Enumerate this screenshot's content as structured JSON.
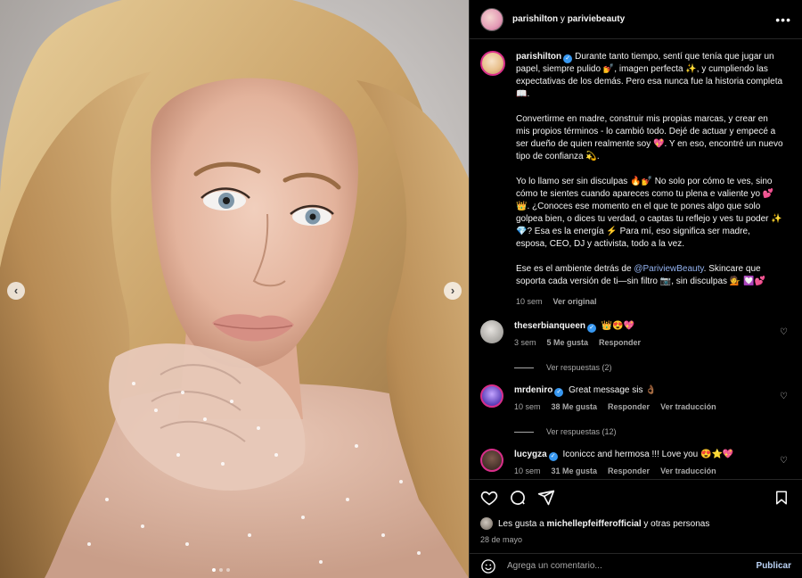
{
  "header": {
    "user1": "parishilton",
    "connector": " y ",
    "user2": "pariviebeauty",
    "more_icon": "more-horizontal-icon"
  },
  "post": {
    "username": "parishilton",
    "paragraphs": [
      "Durante tanto tiempo, sentí que tenía que jugar un papel, siempre pulido 💅, imagen perfecta ✨, y cumpliendo las expectativas de los demás. Pero esa nunca fue la historia completa 📖.",
      "Convertirme en madre, construir mis propias marcas, y crear en mis propios términos - lo cambió todo. Dejé de actuar y empecé a ser dueño de quien realmente soy 💖. Y en eso, encontré un nuevo tipo de confianza 💫.",
      "Yo lo llamo ser sin disculpas 🔥💅 No solo por cómo te ves, sino cómo te sientes cuando apareces como tu plena e valiente yo 💕👑. ¿Conoces ese momento en el que te pones algo que solo golpea bien, o dices tu verdad, o captas tu reflejo y ves tu poder ✨💎? Esa es la energía ⚡ Para mí, eso significa ser madre, esposa, CEO, DJ y activista, todo a la vez."
    ],
    "last_prefix": "Ese es el ambiente detrás de ",
    "last_mention": "@PariviewBeauty",
    "last_suffix": ". Skincare que soporta cada versión de ti—sin filtro 📷, sin disculpas 💁 💟💕",
    "time": "10 sem",
    "see_original": "Ver original"
  },
  "comments": [
    {
      "username": "theserbianqueen",
      "text": "👑😍💖",
      "time": "3 sem",
      "likes": "5 Me gusta",
      "reply": "Responder",
      "translate": "",
      "replies": "Ver respuestas (2)"
    },
    {
      "username": "mrdeniro",
      "text": "Great message sis 👌🏾",
      "time": "10 sem",
      "likes": "38 Me gusta",
      "reply": "Responder",
      "translate": "Ver traducción",
      "replies": "Ver respuestas (12)"
    },
    {
      "username": "lucygza",
      "text": "Iconiccc and hermosa !!! Love you 😍⭐💖",
      "time": "10 sem",
      "likes": "31 Me gusta",
      "reply": "Responder",
      "translate": "Ver traducción",
      "replies": ""
    }
  ],
  "likes": {
    "prefix": "Les gusta a ",
    "user": "michellepfeifferofficial",
    "suffix": " y otras personas"
  },
  "date": "28 de mayo",
  "composer": {
    "placeholder": "Agrega un comentario...",
    "publish": "Publicar"
  },
  "carousel": {
    "slide_count": 3,
    "current_index": 0
  },
  "colors": {
    "background": "#000000",
    "verified": "#3797f0",
    "mention": "#94b3f0",
    "ring": "#d92e8a"
  }
}
